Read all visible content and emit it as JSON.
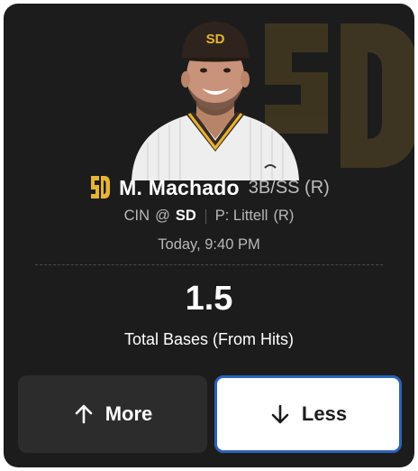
{
  "player": {
    "name": "M. Machado",
    "position": "3B/SS (R)",
    "team_abbr": "SD",
    "team_logo_icon": "padres-sd-logo-icon",
    "headshot": "player-headshot"
  },
  "matchup": {
    "away": "CIN",
    "at": "@",
    "home": "SD",
    "pitcher_label": "P: Littell",
    "pitcher_hand": "(R)"
  },
  "game_time": "Today, 9:40 PM",
  "projection": {
    "line": "1.5",
    "stat": "Total Bases (From Hits)"
  },
  "actions": {
    "more_label": "More",
    "more_icon": "arrow-up-icon",
    "less_label": "Less",
    "less_icon": "arrow-down-icon",
    "selected": "less"
  },
  "colors": {
    "card_bg": "#1c1c1c",
    "team_gold": "#e7b435",
    "team_brown": "#2f241d",
    "selected_border": "#2c63b8",
    "more_button_bg": "#2c2c2c"
  }
}
